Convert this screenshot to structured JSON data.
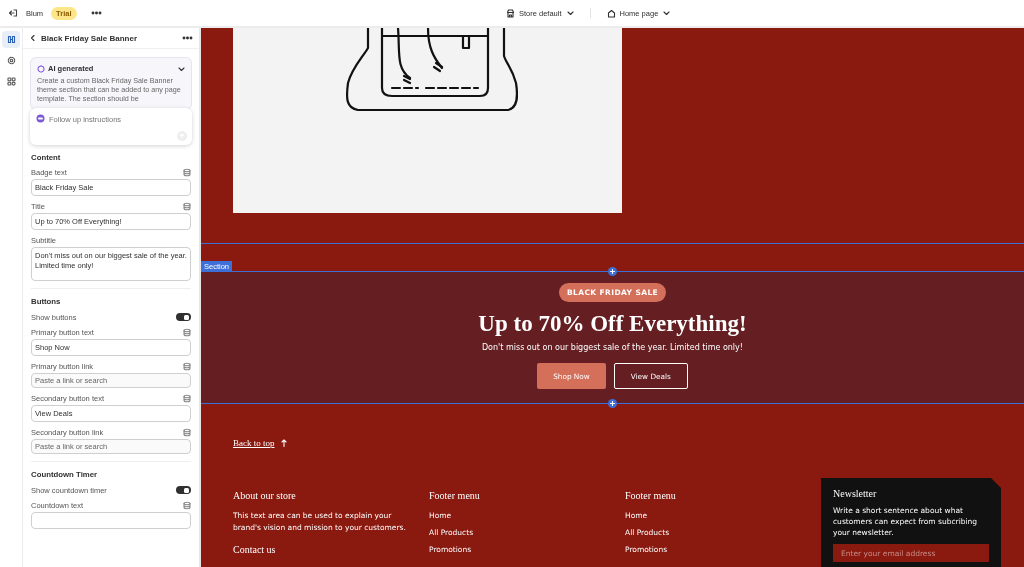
{
  "topbar": {
    "store_name": "Blum",
    "badge": "Trial",
    "theme_selector": "Store default",
    "page_selector": "Home page"
  },
  "rail": [
    {
      "kind": "sections",
      "selected": true
    },
    {
      "kind": "settings",
      "selected": false
    },
    {
      "kind": "apps",
      "selected": false
    }
  ],
  "panel": {
    "title": "Black Friday Sale Banner",
    "ai": {
      "label": "AI generated",
      "description": "Create a custom Black Friday Sale Banner theme section that can be added to any page template. The section should be"
    },
    "prompt": {
      "placeholder": "Follow up instructions"
    },
    "settings": [
      {
        "kind": "heading",
        "label": "Content"
      },
      {
        "kind": "text",
        "label": "Badge text",
        "value": "Black Friday Sale",
        "source_icon": true
      },
      {
        "kind": "text",
        "label": "Title",
        "value": "Up to 70% Off Everything!",
        "source_icon": true
      },
      {
        "kind": "textarea",
        "label": "Subtitle",
        "value": "Don't miss out on our biggest sale of the year. Limited time only!",
        "source_icon": false
      },
      {
        "kind": "heading",
        "label": "Buttons"
      },
      {
        "kind": "toggle",
        "label": "Show buttons",
        "on": true
      },
      {
        "kind": "text",
        "label": "Primary button text",
        "value": "Shop Now",
        "source_icon": true
      },
      {
        "kind": "link",
        "label": "Primary button link",
        "placeholder": "Paste a link or search",
        "source_icon": true
      },
      {
        "kind": "text",
        "label": "Secondary button text",
        "value": "View Deals",
        "source_icon": true
      },
      {
        "kind": "link",
        "label": "Secondary button link",
        "placeholder": "Paste a link or search",
        "source_icon": true
      },
      {
        "kind": "heading",
        "label": "Countdown Timer"
      },
      {
        "kind": "toggle",
        "label": "Show countdown timer",
        "on": true
      },
      {
        "kind": "text",
        "label": "Countdown text",
        "source_icon": true
      }
    ]
  },
  "preview": {
    "section_tag": "Section",
    "banner": {
      "badge": "BLACK FRIDAY SALE",
      "title": "Up to 70% Off Everything!",
      "subtitle": "Don't miss out on our biggest sale of the year. Limited time only!",
      "buttons": [
        {
          "label": "Shop Now",
          "kind": "primary"
        },
        {
          "label": "View Deals",
          "kind": "secondary"
        }
      ]
    },
    "back_to_top": "Back to top",
    "footer": {
      "columns": [
        {
          "kind": "text",
          "heading": "About our store",
          "text": "This text area can be used to explain your brand's vision and mission to your customers.",
          "next_heading": "Contact us"
        },
        {
          "kind": "menu",
          "heading": "Footer menu",
          "links": [
            "Home",
            "All Products",
            "Promotions"
          ]
        },
        {
          "kind": "menu",
          "heading": "Footer menu",
          "links": [
            "Home",
            "All Products",
            "Promotions"
          ]
        }
      ],
      "newsletter": {
        "heading": "Newsletter",
        "text": "Write a short sentence about what customers can expect from subcribing your newsletter.",
        "placeholder": "Enter your email address"
      }
    }
  }
}
